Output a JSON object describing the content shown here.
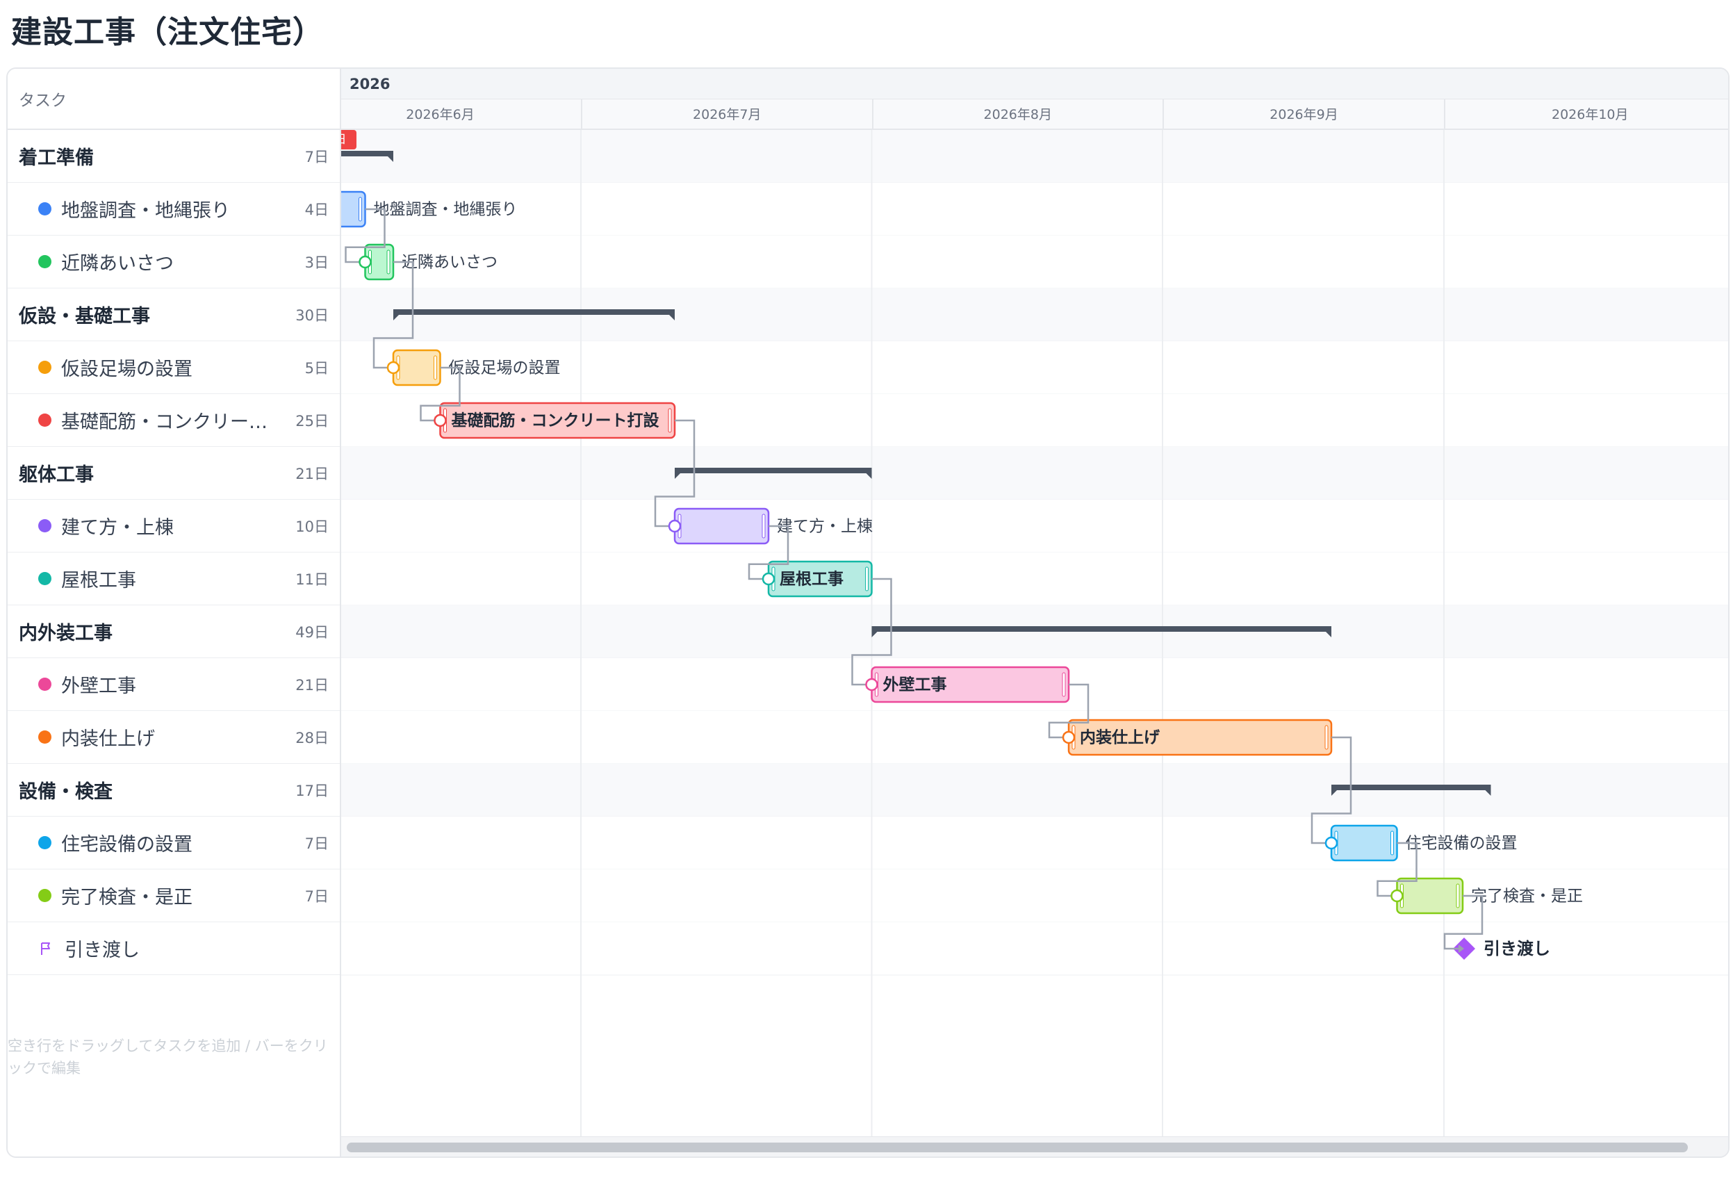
{
  "page": {
    "title": "建設工事（注文住宅）"
  },
  "task_list": {
    "header": "タスク",
    "hint": "空き行をドラッグしてタスクを追加 / バーをクリックで編集"
  },
  "timeline": {
    "year": "2026",
    "today_label": "今日",
    "months": [
      {
        "label": "2026年6月",
        "days": 30
      },
      {
        "label": "2026年7月",
        "days": 31
      },
      {
        "label": "2026年8月",
        "days": 31
      },
      {
        "label": "2026年9月",
        "days": 30
      },
      {
        "label": "2026年10月",
        "days": 31
      }
    ],
    "today": "2026-06-04"
  },
  "rows": [
    {
      "id": "g1",
      "type": "group",
      "name": "着工準備",
      "duration": "7日",
      "start": "2026-06-04",
      "days": 7
    },
    {
      "id": "t1",
      "type": "task",
      "name": "地盤調査・地縄張り",
      "duration": "4日",
      "start": "2026-06-04",
      "days": 4,
      "color": "#3b82f6",
      "fill": "#bfdbfe"
    },
    {
      "id": "t2",
      "type": "task",
      "name": "近隣あいさつ",
      "duration": "3日",
      "start": "2026-06-08",
      "days": 3,
      "color": "#22c55e",
      "fill": "#bbf7d0"
    },
    {
      "id": "g2",
      "type": "group",
      "name": "仮設・基礎工事",
      "duration": "30日",
      "start": "2026-06-11",
      "days": 30
    },
    {
      "id": "t3",
      "type": "task",
      "name": "仮設足場の設置",
      "duration": "5日",
      "start": "2026-06-11",
      "days": 5,
      "color": "#f59e0b",
      "fill": "#fde5b5"
    },
    {
      "id": "t4",
      "type": "task",
      "name": "基礎配筋・コンクリート打設",
      "display_name": "基礎配筋・コンクリー…",
      "duration": "25日",
      "start": "2026-06-16",
      "days": 25,
      "color": "#ef4444",
      "fill": "#fecaca"
    },
    {
      "id": "g3",
      "type": "group",
      "name": "躯体工事",
      "duration": "21日",
      "start": "2026-07-11",
      "days": 21
    },
    {
      "id": "t5",
      "type": "task",
      "name": "建て方・上棟",
      "duration": "10日",
      "start": "2026-07-11",
      "days": 10,
      "color": "#8b5cf6",
      "fill": "#ddd6fe"
    },
    {
      "id": "t6",
      "type": "task",
      "name": "屋根工事",
      "duration": "11日",
      "start": "2026-07-21",
      "days": 11,
      "color": "#14b8a6",
      "fill": "#b6ebe2"
    },
    {
      "id": "g4",
      "type": "group",
      "name": "内外装工事",
      "duration": "49日",
      "start": "2026-08-01",
      "days": 49
    },
    {
      "id": "t7",
      "type": "task",
      "name": "外壁工事",
      "duration": "21日",
      "start": "2026-08-01",
      "days": 21,
      "color": "#ec4899",
      "fill": "#fbc7e1"
    },
    {
      "id": "t8",
      "type": "task",
      "name": "内装仕上げ",
      "duration": "28日",
      "start": "2026-08-22",
      "days": 28,
      "color": "#f97316",
      "fill": "#fed7b5"
    },
    {
      "id": "g5",
      "type": "group",
      "name": "設備・検査",
      "duration": "17日",
      "start": "2026-09-19",
      "days": 17
    },
    {
      "id": "t9",
      "type": "task",
      "name": "住宅設備の設置",
      "duration": "7日",
      "start": "2026-09-19",
      "days": 7,
      "color": "#0ea5e9",
      "fill": "#b6e3f9"
    },
    {
      "id": "t10",
      "type": "task",
      "name": "完了検査・是正",
      "duration": "7日",
      "start": "2026-09-26",
      "days": 7,
      "color": "#84cc16",
      "fill": "#d9f2b8"
    },
    {
      "id": "m1",
      "type": "milestone",
      "name": "引き渡し",
      "duration": "",
      "start": "2026-10-03",
      "days": 0,
      "color": "#a855f7"
    }
  ],
  "dependencies": [
    [
      "t1",
      "t2"
    ],
    [
      "t2",
      "t3"
    ],
    [
      "t3",
      "t4"
    ],
    [
      "t4",
      "t5"
    ],
    [
      "t5",
      "t6"
    ],
    [
      "t6",
      "t7"
    ],
    [
      "t7",
      "t8"
    ],
    [
      "t8",
      "t9"
    ],
    [
      "t9",
      "t10"
    ],
    [
      "t10",
      "m1"
    ]
  ]
}
